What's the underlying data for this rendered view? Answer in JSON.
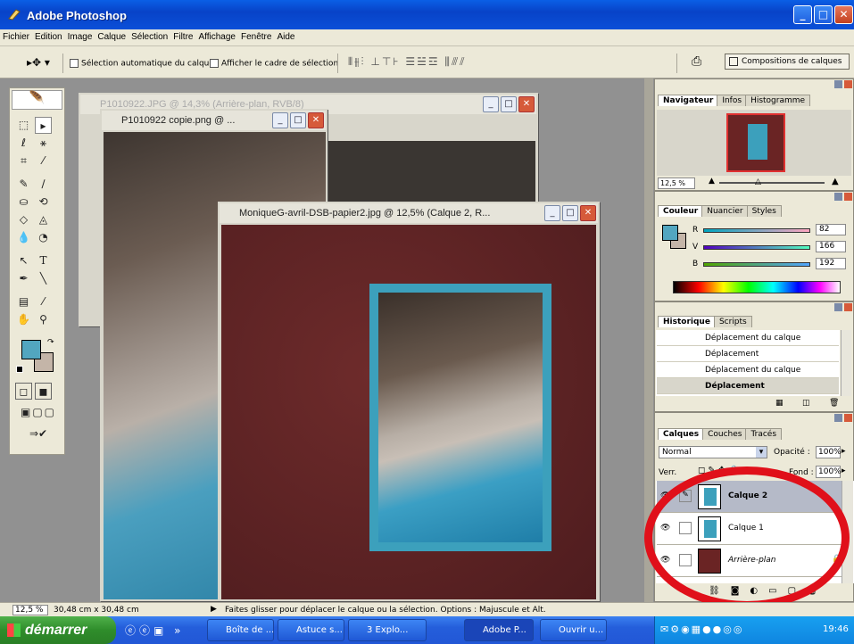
{
  "app": {
    "title": "Adobe Photoshop"
  },
  "menu": [
    "Fichier",
    "Edition",
    "Image",
    "Calque",
    "Sélection",
    "Filtre",
    "Affichage",
    "Fenêtre",
    "Aide"
  ],
  "options": {
    "auto_select": "Sélection automatique du calque",
    "show_bounds": "Afficher le cadre de sélection",
    "compositions": "Compositions de calques"
  },
  "docs": {
    "back": {
      "title": "P1010922.JPG @ 14,3% (Arrière-plan, RVB/8)"
    },
    "middle": {
      "title": "P1010922 copie.png @ ..."
    },
    "front": {
      "title": "MoniqueG-avril-DSB-papier2.jpg @ 12,5% (Calque 2, R..."
    }
  },
  "navigator": {
    "tabs": [
      "Navigateur",
      "Infos",
      "Histogramme"
    ],
    "zoom": "12,5 %"
  },
  "color": {
    "tabs": [
      "Couleur",
      "Nuancier",
      "Styles"
    ],
    "channels": [
      {
        "label": "R",
        "value": "82"
      },
      {
        "label": "V",
        "value": "166"
      },
      {
        "label": "B",
        "value": "192"
      }
    ],
    "fg": "#52a6c0",
    "bg": "#c4b5a8"
  },
  "history": {
    "tabs": [
      "Historique",
      "Scripts"
    ],
    "items": [
      "Déplacement du calque",
      "Déplacement",
      "Déplacement du calque",
      "Déplacement"
    ]
  },
  "layers": {
    "tabs": [
      "Calques",
      "Couches",
      "Tracés"
    ],
    "blend": "Normal",
    "opacity_label": "Opacité :",
    "opacity": "100%",
    "lock_label": "Verr.",
    "fill_label": "Fond :",
    "fill": "100%",
    "items": [
      "Calque 2",
      "Calque 1",
      "Arrière-plan"
    ]
  },
  "status": {
    "zoom": "12,5 %",
    "size": "30,48 cm x 30,48 cm",
    "hint": "Faites glisser pour déplacer le calque ou la sélection. Options : Majuscule et Alt."
  },
  "taskbar": {
    "start": "démarrer",
    "items": [
      "Boîte de ...",
      "Astuce s...",
      "3 Explo...",
      "Adobe P...",
      "Ouvrir u..."
    ],
    "clock": "19:46"
  }
}
